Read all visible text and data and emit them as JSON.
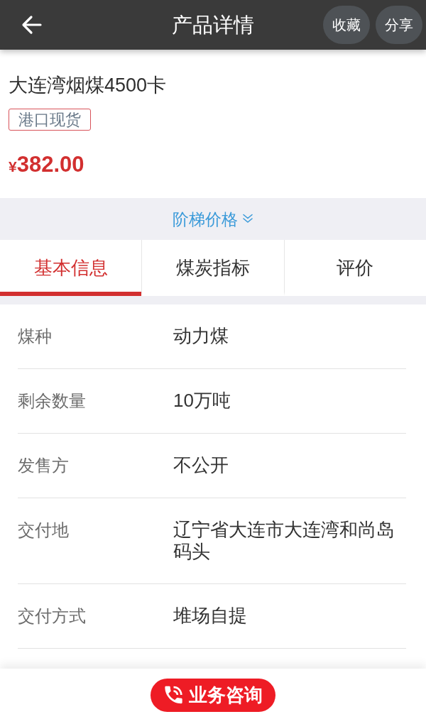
{
  "header": {
    "title": "产品详情",
    "actions": [
      {
        "label": "收藏"
      },
      {
        "label": "分享"
      }
    ]
  },
  "product": {
    "name": "大连湾烟煤4500卡",
    "tag": "港口现货",
    "currency": "¥",
    "amount": "382.00"
  },
  "tier_price": {
    "label": "阶梯价格",
    "expanded": false
  },
  "tabs": [
    {
      "label": "基本信息",
      "selected": true
    },
    {
      "label": "煤炭指标",
      "selected": false
    },
    {
      "label": "评价",
      "selected": false
    }
  ],
  "info": [
    {
      "label": "煤种",
      "value": "动力煤"
    },
    {
      "label": "剩余数量",
      "value": "10万吨"
    },
    {
      "label": "发售方",
      "value": "不公开"
    },
    {
      "label": "交付地",
      "value": "辽宁省大连市大连湾和尚岛码头"
    },
    {
      "label": "交付方式",
      "value": "堆场自提"
    }
  ],
  "consult_button": {
    "label": "业务咨询"
  }
}
